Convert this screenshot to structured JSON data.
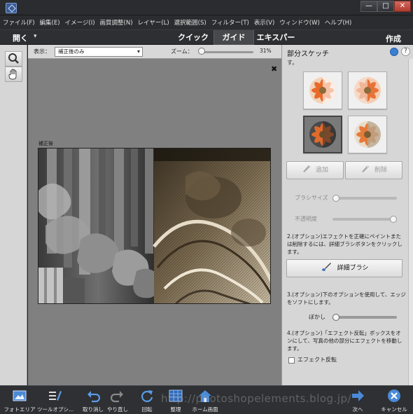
{
  "window": {
    "min_label": "—",
    "max_label": "□",
    "close_label": "✕"
  },
  "menu": [
    "ファイル(F)",
    "編集(E)",
    "イメージ(I)",
    "画質調整(N)",
    "レイヤー(L)",
    "選択範囲(S)",
    "フィルター(T)",
    "表示(V)",
    "ウィンドウ(W)",
    "ヘルプ(H)"
  ],
  "modebar": {
    "open_label": "開く",
    "open_caret": "▾",
    "tabs": [
      "クイック",
      "ガイド",
      "エキスパート"
    ],
    "active_tab": "ガイド",
    "create_label": "作成"
  },
  "options": {
    "view_label": "表示：",
    "view_value": "補正後のみ",
    "zoom_label": "ズーム：",
    "zoom_value": "31%",
    "zoom_level": 0.05
  },
  "canvas": {
    "close_label": "✖",
    "after_label": "補正後",
    "background": "#808080"
  },
  "panel": {
    "title": "部分スケッチ",
    "help_label": "?",
    "fade_text": "す。",
    "add_label": "追加",
    "delete_label": "削除",
    "brush_size_label": "ブラシサイズ",
    "opacity_label": "不透明度",
    "step2_text": "2.(オプション)エフェクトを正確にペイントまたは削除するには、詳細ブラシボタンをクリックします。",
    "detail_brush_label": "詳細ブラシ",
    "step3_text": "3.(オプション)下のオプションを使用して、エッジをソフトにします。",
    "blur_label": "ぼかし",
    "step4_text": "4.(オプション)「エフェクト反転」ボックスをオンにして、写真の他の部分にエフェクトを移動します。",
    "invert_label": "エフェクト反転",
    "invert_checked": false
  },
  "bottombar": {
    "photo_area": "フォトエリア",
    "tool_options": "ツールオプシ...",
    "undo": "取り消し",
    "redo": "やり直し",
    "rotate": "回転",
    "organize": "整理",
    "home": "ホーム画面",
    "next": "次へ",
    "cancel": "キャンセル"
  },
  "watermark": "http://photoshopelements.blog.jp/"
}
